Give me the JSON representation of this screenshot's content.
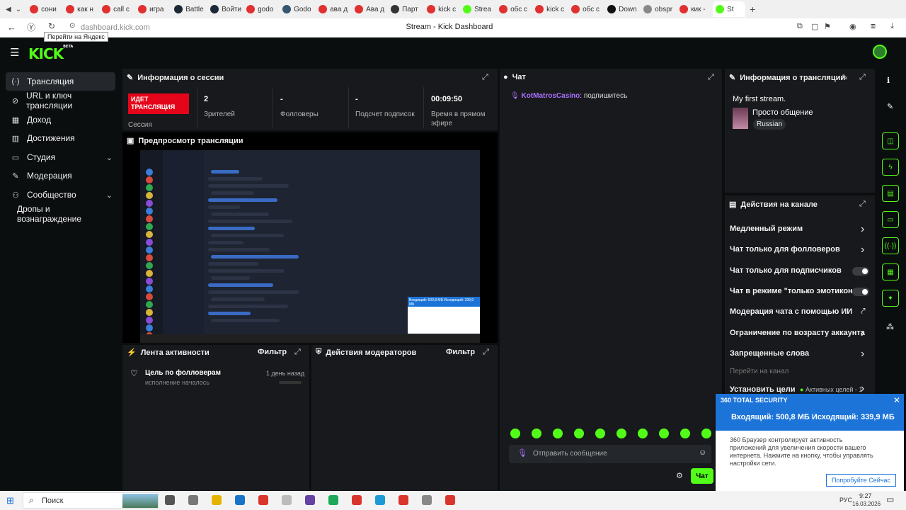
{
  "browser": {
    "tabs": [
      "сони",
      "как н",
      "call c",
      "игра",
      "Battle",
      "Войти",
      "godo",
      "Godo",
      "ава д",
      "Ава д",
      "Парт",
      "kick c",
      "Strea",
      "обс с",
      "kick c",
      "обс с",
      "Down",
      "obspr",
      "кик -",
      "St"
    ],
    "tab_colors": [
      "#e03030",
      "#e03030",
      "#e03030",
      "#e03030",
      "#1b2838",
      "#1b2838",
      "#e03030",
      "#355570",
      "#e03030",
      "#e03030",
      "#333",
      "#e03030",
      "#53fc18",
      "#e03030",
      "#e03030",
      "#e03030",
      "#111",
      "#888",
      "#e03030",
      "#53fc18"
    ],
    "url": "dashboard.kick.com",
    "page_title": "Stream - Kick Dashboard",
    "tooltip": "Перейти на Яндекс"
  },
  "kick": {
    "logo": "KICK",
    "logo_beta": "BETA",
    "accent": "#53fc18",
    "live_color": "#e4051a"
  },
  "nav": {
    "items": [
      {
        "label": "Трансляция",
        "icon": "broadcast-icon"
      },
      {
        "label": "URL и ключ трансляции",
        "icon": "key-icon"
      },
      {
        "label": "Доход",
        "icon": "revenue-icon"
      },
      {
        "label": "Достижения",
        "icon": "achievements-icon"
      },
      {
        "label": "Студия",
        "icon": "studio-icon"
      },
      {
        "label": "Модерация",
        "icon": "wrench-icon"
      },
      {
        "label": "Сообщество",
        "icon": "community-icon"
      },
      {
        "label": "Дропы и вознаграждение",
        "icon": ""
      }
    ]
  },
  "session": {
    "title": "Информация о сессии",
    "live_badge": "ИДЕТ ТРАНСЛЯЦИЯ",
    "session_label": "Сессия",
    "stats": [
      {
        "value": "2",
        "label": "Зрителей"
      },
      {
        "value": "-",
        "label": "Фолловеры"
      },
      {
        "value": "-",
        "label": "Подсчет подписок"
      },
      {
        "value": "00:09:50",
        "label": "Время в прямом эфире"
      }
    ]
  },
  "preview": {
    "title": "Предпросмотр трансляции",
    "popup_text": "360 Total Security",
    "popup_line": "Входящий: 500,8 МБ Исходящий: 339,9 МБ"
  },
  "activity": {
    "title": "Лента активности",
    "filter": "Фильтр",
    "item_title": "Цель по фолловерам",
    "item_sub": "исполнение началось",
    "item_time": "1 день назад"
  },
  "mod_actions": {
    "title": "Действия модераторов",
    "filter": "Фильтр"
  },
  "chat": {
    "title": "Чат",
    "msg_user": "KotMatrosCasino",
    "msg_text": ": подпишитесь",
    "input_placeholder": "Отправить сообщение",
    "send": "Чат"
  },
  "stream_info": {
    "title": "Информация о трансляции",
    "stream_title": "My first stream.",
    "category": "Просто общение",
    "language": "Russian"
  },
  "channel_actions": {
    "title": "Действия на канале",
    "items": [
      {
        "label": "Медленный режим",
        "control": "arrow"
      },
      {
        "label": "Чат только для фолловеров",
        "control": "arrow"
      },
      {
        "label": "Чат только для подписчиков",
        "control": "toggle"
      },
      {
        "label": "Чат в режиме \"только эмотиконы\"",
        "control": "toggle"
      },
      {
        "label": "Модерация чата с помощью ИИ",
        "control": "external"
      },
      {
        "label": "Ограничение по возрасту аккаунта",
        "control": "arrow"
      },
      {
        "label": "Запрещенные слова",
        "control": "arrow"
      }
    ],
    "goto_channel": "Перейти на канал",
    "set_goals": "Установить цели",
    "active_goals": "Активных целей - 1"
  },
  "security_popup": {
    "brand": "360 TOTAL SECURITY",
    "traffic": "Входящий: 500,8 МБ Исходящий: 339,9 МБ",
    "body": "360 Браузер контролирует активность приложений для увеличения скорости вашего интернета. Нажмите на кнопку, чтобы управлять настройки сети.",
    "button": "Попробуйте Сейчас"
  },
  "taskbar": {
    "search": "Поиск",
    "lang": "РУС",
    "time": "9:27",
    "date": "16.03.2026"
  }
}
